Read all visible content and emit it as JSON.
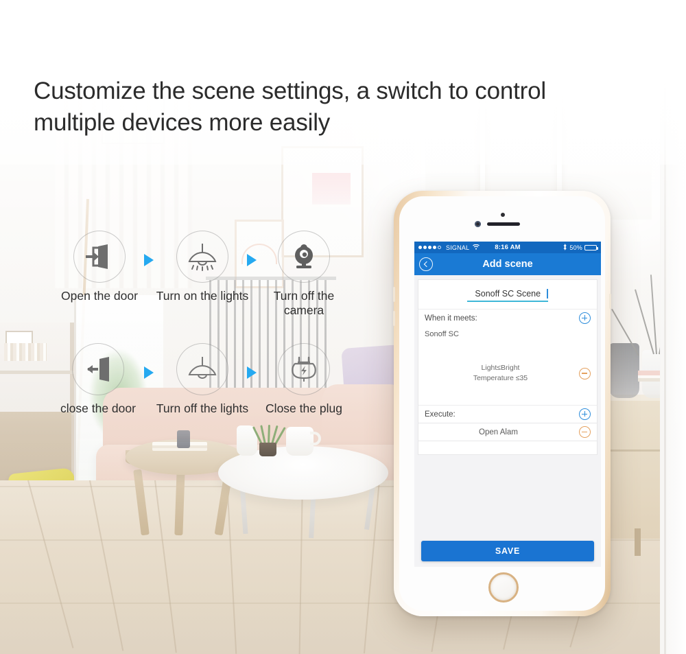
{
  "headline": "Customize the scene settings, a switch to control multiple devices more easily",
  "flow": {
    "row1": [
      {
        "icon": "door-open-icon",
        "label": "Open the door"
      },
      {
        "icon": "pendant-lamp-on-icon",
        "label": "Turn on the lights"
      },
      {
        "icon": "webcam-icon",
        "label": "Turn off the camera"
      }
    ],
    "row2": [
      {
        "icon": "door-close-icon",
        "label": "close the door"
      },
      {
        "icon": "pendant-lamp-off-icon",
        "label": "Turn off the lights"
      },
      {
        "icon": "power-plug-icon",
        "label": "Close the plug"
      }
    ]
  },
  "phone": {
    "status_bar": {
      "carrier": "SIGNAL",
      "wifi_icon": "wifi-icon",
      "time": "8:16 AM",
      "bluetooth_icon": "bluetooth-icon",
      "battery_percent": "50%",
      "battery_level": 50,
      "signal_dots_filled": 4,
      "signal_dots_total": 5
    },
    "nav": {
      "back_icon": "chevron-left-icon",
      "title": "Add scene"
    },
    "form": {
      "scene_name_value": "Sonoff SC Scene",
      "scene_name_placeholder": "Scene name",
      "when_label": "When it meets:",
      "when_add_icon": "plus-circle-icon",
      "trigger_device": "Sonoff SC",
      "condition_line1": "Light≤Bright",
      "condition_line2": "Temperature ≤35",
      "condition_remove_icon": "minus-circle-icon",
      "execute_label": "Execute:",
      "execute_add_icon": "plus-circle-icon",
      "execute_items": [
        {
          "name": "Open Alam",
          "remove_icon": "minus-circle-icon"
        }
      ],
      "save_label": "SAVE"
    }
  },
  "colors": {
    "nav_blue": "#1a7ad4",
    "status_blue": "#1268bf",
    "save_blue": "#1a74d2",
    "accent_teal": "#3fb7d8",
    "arrow_blue": "#25a9f0",
    "minus_orange": "#e4a05e",
    "plus_blue": "#2d8ddb",
    "headline_text": "#2b2b2b"
  }
}
